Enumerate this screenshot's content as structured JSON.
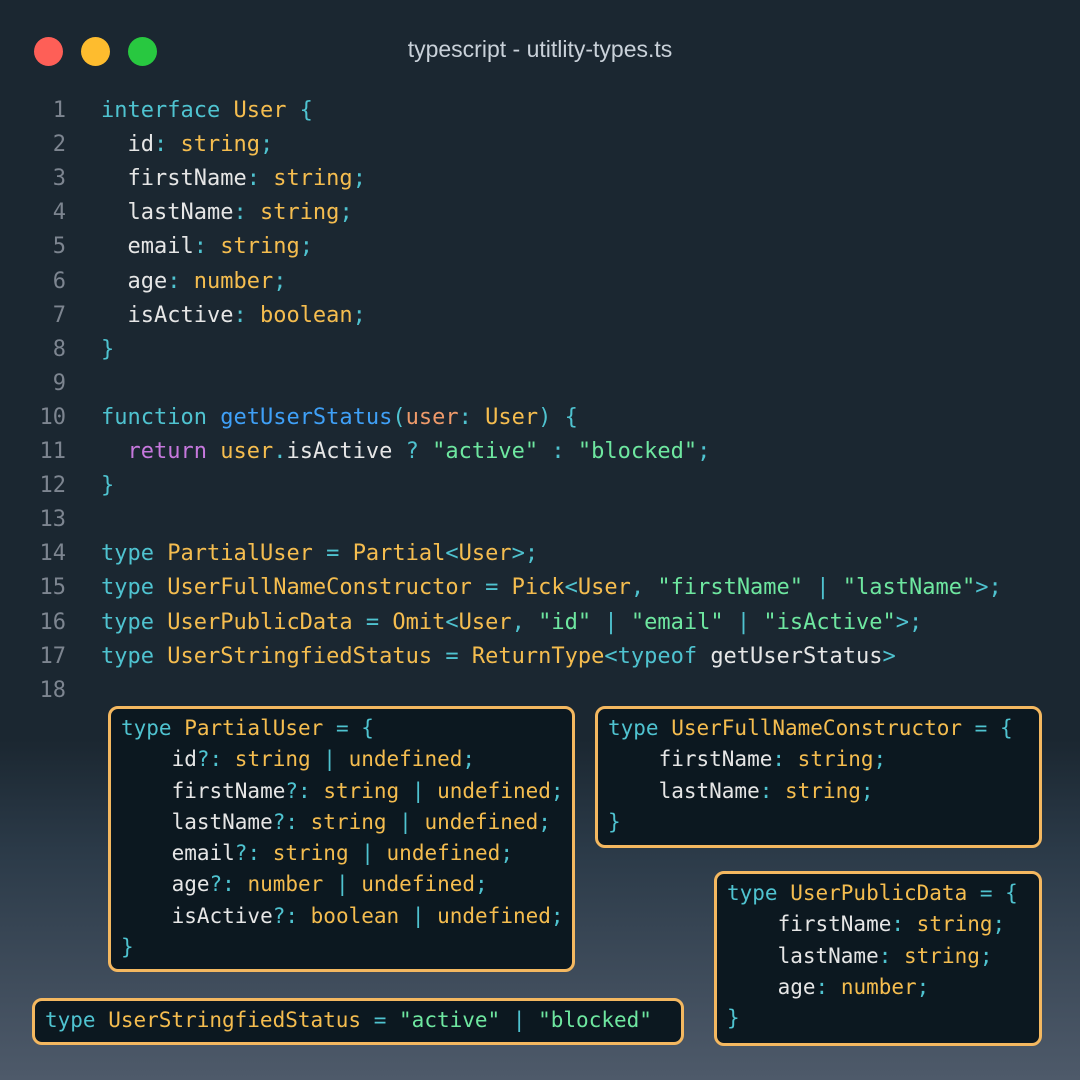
{
  "window": {
    "title": "typescript - utitlity-types.ts",
    "controls": [
      "close",
      "minimize",
      "maximize"
    ]
  },
  "code_lines": [
    {
      "n": "1",
      "tokens": [
        [
          "kw",
          "interface "
        ],
        [
          "ty",
          "User"
        ],
        [
          "pu",
          " {"
        ]
      ]
    },
    {
      "n": "2",
      "tokens": [
        [
          "id",
          "  id"
        ],
        [
          "pu",
          ": "
        ],
        [
          "ty",
          "string"
        ],
        [
          "pu",
          ";"
        ]
      ]
    },
    {
      "n": "3",
      "tokens": [
        [
          "id",
          "  firstName"
        ],
        [
          "pu",
          ": "
        ],
        [
          "ty",
          "string"
        ],
        [
          "pu",
          ";"
        ]
      ]
    },
    {
      "n": "4",
      "tokens": [
        [
          "id",
          "  lastName"
        ],
        [
          "pu",
          ": "
        ],
        [
          "ty",
          "string"
        ],
        [
          "pu",
          ";"
        ]
      ]
    },
    {
      "n": "5",
      "tokens": [
        [
          "id",
          "  email"
        ],
        [
          "pu",
          ": "
        ],
        [
          "ty",
          "string"
        ],
        [
          "pu",
          ";"
        ]
      ]
    },
    {
      "n": "6",
      "tokens": [
        [
          "id",
          "  age"
        ],
        [
          "pu",
          ": "
        ],
        [
          "ty",
          "number"
        ],
        [
          "pu",
          ";"
        ]
      ]
    },
    {
      "n": "7",
      "tokens": [
        [
          "id",
          "  isActive"
        ],
        [
          "pu",
          ": "
        ],
        [
          "ty",
          "boolean"
        ],
        [
          "pu",
          ";"
        ]
      ]
    },
    {
      "n": "8",
      "tokens": [
        [
          "pu",
          "}"
        ]
      ]
    },
    {
      "n": "9",
      "tokens": []
    },
    {
      "n": "10",
      "tokens": [
        [
          "kw",
          "function "
        ],
        [
          "fn",
          "getUserStatus"
        ],
        [
          "pu",
          "("
        ],
        [
          "pr",
          "user"
        ],
        [
          "pu",
          ": "
        ],
        [
          "ty",
          "User"
        ],
        [
          "pu",
          ") {"
        ]
      ]
    },
    {
      "n": "11",
      "tokens": [
        [
          "id",
          "  "
        ],
        [
          "ret",
          "return "
        ],
        [
          "ty",
          "user"
        ],
        [
          "pu",
          "."
        ],
        [
          "id",
          "isActive "
        ],
        [
          "pu",
          "? "
        ],
        [
          "st",
          "\"active\""
        ],
        [
          "pu",
          " : "
        ],
        [
          "st",
          "\"blocked\""
        ],
        [
          "pu",
          ";"
        ]
      ]
    },
    {
      "n": "12",
      "tokens": [
        [
          "pu",
          "}"
        ]
      ]
    },
    {
      "n": "13",
      "tokens": []
    },
    {
      "n": "14",
      "tokens": [
        [
          "kw",
          "type "
        ],
        [
          "ty",
          "PartialUser"
        ],
        [
          "pu",
          " = "
        ],
        [
          "ty",
          "Partial"
        ],
        [
          "pu",
          "<"
        ],
        [
          "ty",
          "User"
        ],
        [
          "pu",
          ">;"
        ]
      ]
    },
    {
      "n": "15",
      "tokens": [
        [
          "kw",
          "type "
        ],
        [
          "ty",
          "UserFullNameConstructor"
        ],
        [
          "pu",
          " = "
        ],
        [
          "ty",
          "Pick"
        ],
        [
          "pu",
          "<"
        ],
        [
          "ty",
          "User"
        ],
        [
          "pu",
          ", "
        ],
        [
          "st",
          "\"firstName\""
        ],
        [
          "pu",
          " | "
        ],
        [
          "st",
          "\"lastName\""
        ],
        [
          "pu",
          ">;"
        ]
      ]
    },
    {
      "n": "16",
      "tokens": [
        [
          "kw",
          "type "
        ],
        [
          "ty",
          "UserPublicData"
        ],
        [
          "pu",
          " = "
        ],
        [
          "ty",
          "Omit"
        ],
        [
          "pu",
          "<"
        ],
        [
          "ty",
          "User"
        ],
        [
          "pu",
          ", "
        ],
        [
          "st",
          "\"id\""
        ],
        [
          "pu",
          " | "
        ],
        [
          "st",
          "\"email\""
        ],
        [
          "pu",
          " | "
        ],
        [
          "st",
          "\"isActive\""
        ],
        [
          "pu",
          ">;"
        ]
      ]
    },
    {
      "n": "17",
      "tokens": [
        [
          "kw",
          "type "
        ],
        [
          "ty",
          "UserStringfiedStatus"
        ],
        [
          "pu",
          " = "
        ],
        [
          "ty",
          "ReturnType"
        ],
        [
          "pu",
          "<"
        ],
        [
          "kw",
          "typeof "
        ],
        [
          "id",
          "getUserStatus"
        ],
        [
          "pu",
          ">"
        ]
      ]
    },
    {
      "n": "18",
      "tokens": []
    }
  ],
  "boxes": {
    "partial_user": [
      [
        [
          "kw",
          "type "
        ],
        [
          "ty",
          "PartialUser"
        ],
        [
          "pu",
          " = {"
        ]
      ],
      [
        [
          "id",
          "    id"
        ],
        [
          "pu",
          "?: "
        ],
        [
          "ty",
          "string"
        ],
        [
          "pu",
          " | "
        ],
        [
          "ty",
          "undefined"
        ],
        [
          "pu",
          ";"
        ]
      ],
      [
        [
          "id",
          "    firstName"
        ],
        [
          "pu",
          "?: "
        ],
        [
          "ty",
          "string"
        ],
        [
          "pu",
          " | "
        ],
        [
          "ty",
          "undefined"
        ],
        [
          "pu",
          ";"
        ]
      ],
      [
        [
          "id",
          "    lastName"
        ],
        [
          "pu",
          "?: "
        ],
        [
          "ty",
          "string"
        ],
        [
          "pu",
          " | "
        ],
        [
          "ty",
          "undefined"
        ],
        [
          "pu",
          ";"
        ]
      ],
      [
        [
          "id",
          "    email"
        ],
        [
          "pu",
          "?: "
        ],
        [
          "ty",
          "string"
        ],
        [
          "pu",
          " | "
        ],
        [
          "ty",
          "undefined"
        ],
        [
          "pu",
          ";"
        ]
      ],
      [
        [
          "id",
          "    age"
        ],
        [
          "pu",
          "?: "
        ],
        [
          "ty",
          "number"
        ],
        [
          "pu",
          " | "
        ],
        [
          "ty",
          "undefined"
        ],
        [
          "pu",
          ";"
        ]
      ],
      [
        [
          "id",
          "    isActive"
        ],
        [
          "pu",
          "?: "
        ],
        [
          "ty",
          "boolean"
        ],
        [
          "pu",
          " | "
        ],
        [
          "ty",
          "undefined"
        ],
        [
          "pu",
          ";"
        ]
      ],
      [
        [
          "pu",
          "}"
        ]
      ]
    ],
    "full_name_constructor": [
      [
        [
          "kw",
          "type "
        ],
        [
          "ty",
          "UserFullNameConstructor"
        ],
        [
          "pu",
          " = {"
        ]
      ],
      [
        [
          "id",
          "    firstName"
        ],
        [
          "pu",
          ": "
        ],
        [
          "ty",
          "string"
        ],
        [
          "pu",
          ";"
        ]
      ],
      [
        [
          "id",
          "    lastName"
        ],
        [
          "pu",
          ": "
        ],
        [
          "ty",
          "string"
        ],
        [
          "pu",
          ";"
        ]
      ],
      [
        [
          "pu",
          "}"
        ]
      ]
    ],
    "public_data": [
      [
        [
          "kw",
          "type "
        ],
        [
          "ty",
          "UserPublicData"
        ],
        [
          "pu",
          " = {"
        ]
      ],
      [
        [
          "id",
          "    firstName"
        ],
        [
          "pu",
          ": "
        ],
        [
          "ty",
          "string"
        ],
        [
          "pu",
          ";"
        ]
      ],
      [
        [
          "id",
          "    lastName"
        ],
        [
          "pu",
          ": "
        ],
        [
          "ty",
          "string"
        ],
        [
          "pu",
          ";"
        ]
      ],
      [
        [
          "id",
          "    age"
        ],
        [
          "pu",
          ": "
        ],
        [
          "ty",
          "number"
        ],
        [
          "pu",
          ";"
        ]
      ],
      [
        [
          "pu",
          "}"
        ]
      ]
    ],
    "stringfied_status": [
      [
        [
          "kw",
          "type "
        ],
        [
          "ty",
          "UserStringfiedStatus"
        ],
        [
          "pu",
          " = "
        ],
        [
          "st",
          "\"active\""
        ],
        [
          "pu",
          " | "
        ],
        [
          "st",
          "\"blocked\""
        ]
      ]
    ]
  },
  "colors": {
    "background": "#1b2731",
    "box_border": "#f4b860",
    "keyword": "#4fc3d0",
    "type": "#f5bd4f",
    "string": "#6ee7a0",
    "function": "#3fa0f7",
    "return_keyword": "#c678dd",
    "param": "#ef9a6a"
  }
}
